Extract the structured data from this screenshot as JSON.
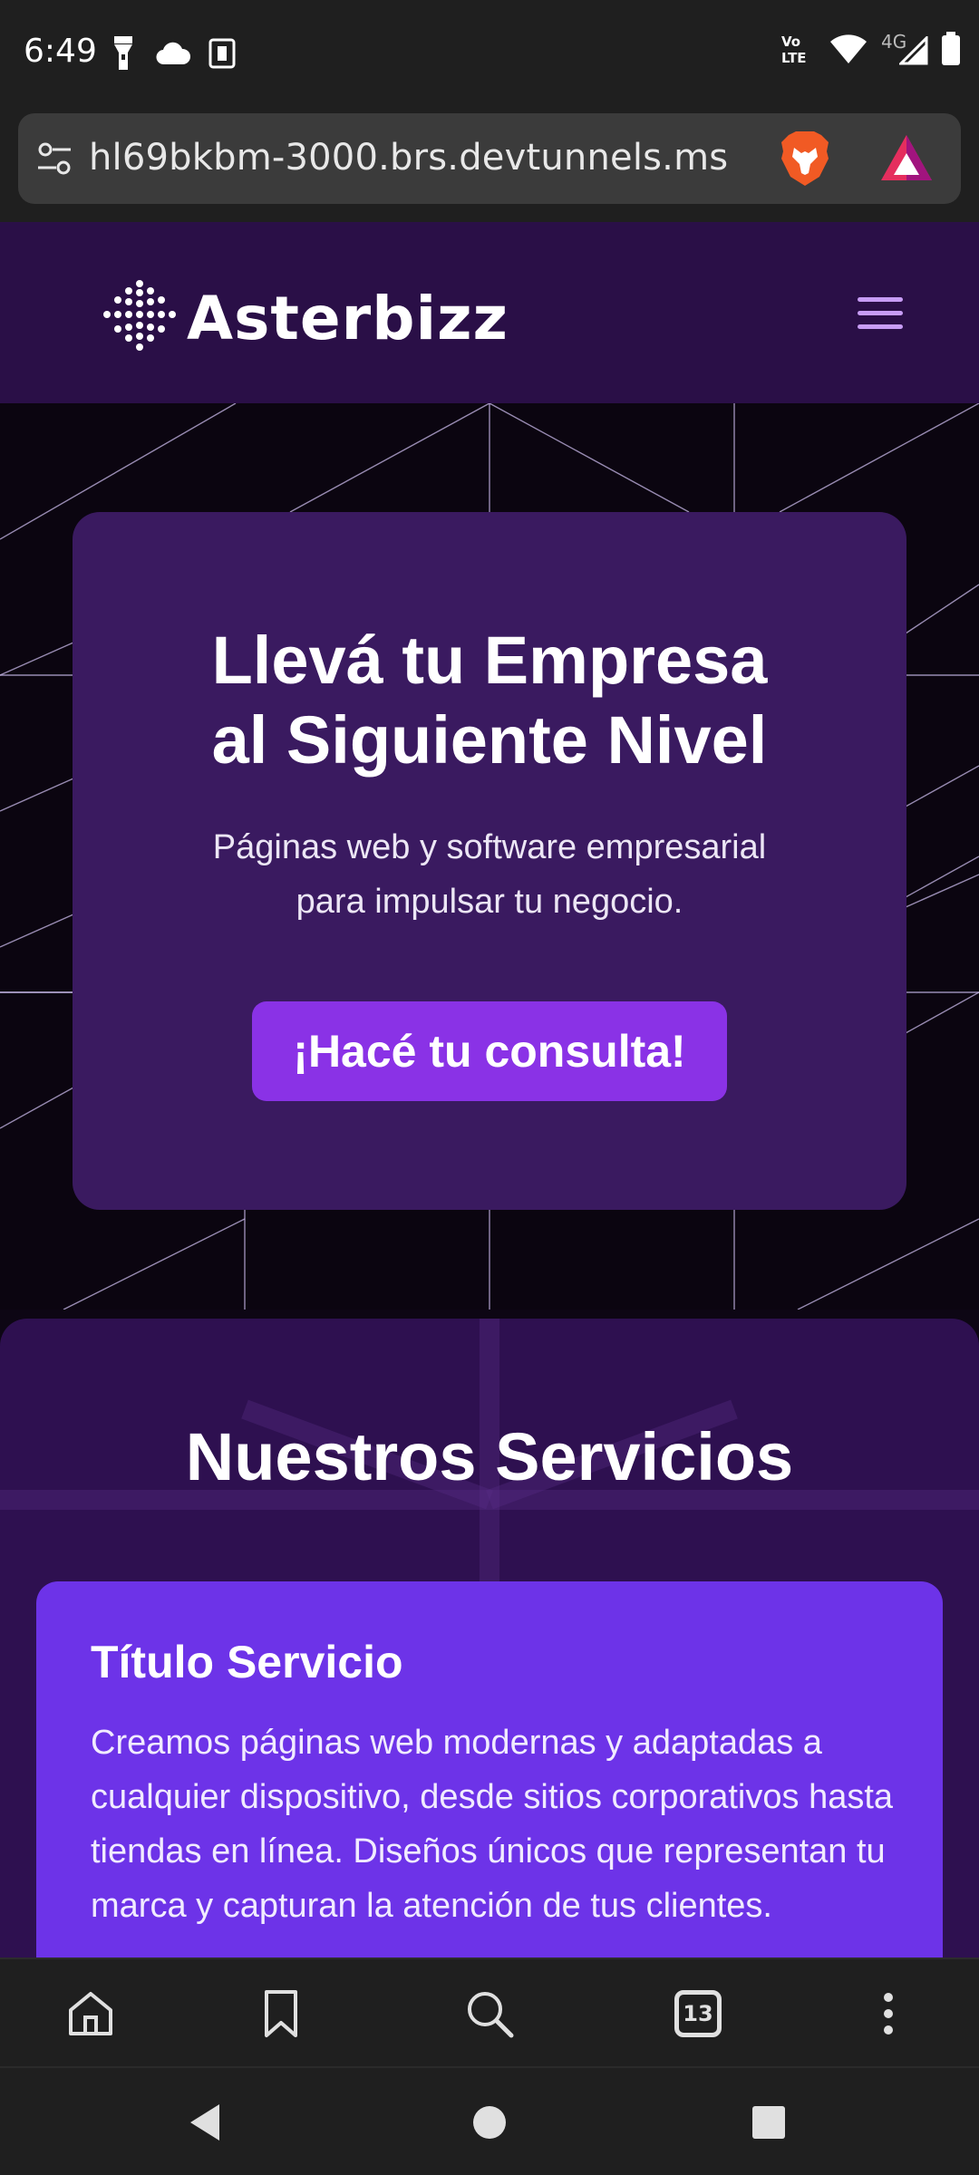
{
  "status_bar": {
    "time": "6:49",
    "network_label": "4G",
    "volte_label": "Vo LTE"
  },
  "browser": {
    "url": "hl69bkbm-3000.brs.devtunnels.ms",
    "tab_count": "13"
  },
  "site": {
    "brand": "Asterbizz",
    "hero": {
      "title_line1": "Llevá tu Empresa",
      "title_line2": "al Siguiente Nivel",
      "subtitle_line1": "Páginas web y software empresarial",
      "subtitle_line2": "para impulsar tu negocio.",
      "cta_label": "¡Hacé tu consulta!"
    },
    "services": {
      "title": "Nuestros Servicios",
      "card": {
        "title": "Título Servicio",
        "body": "Creamos páginas web modernas y adaptadas a cualquier dispositivo, desde sitios corporativos hasta tiendas en línea. Diseños únicos que representan tu marca y capturan la atención de tus clientes."
      }
    }
  },
  "colors": {
    "header_bg": "#2a0f47",
    "hero_card_bg": "#3a1a60",
    "cta_bg": "#8a32e6",
    "services_bg": "#2e1050",
    "service_card_bg": "#6d33e8",
    "menu_icon": "#c79cf5"
  }
}
